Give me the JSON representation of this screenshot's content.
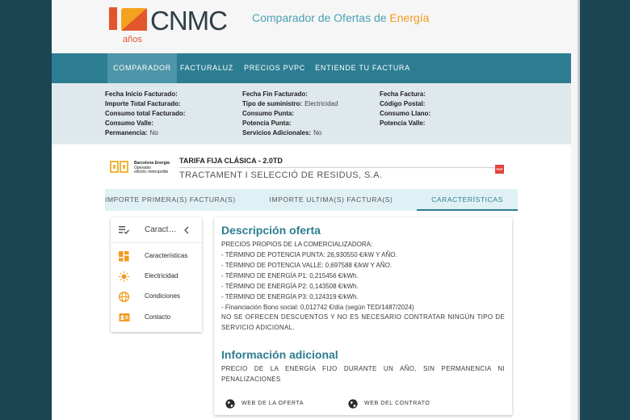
{
  "header": {
    "logo_numeral": "1",
    "logo_years": "años",
    "logo_name": "CNMC",
    "site_title_main": "Comparador de Ofertas de ",
    "site_title_accent": "Energía",
    "accent_color": "#f29a1f",
    "primary_color": "#2d7d92"
  },
  "nav": {
    "items": [
      {
        "label": "COMPARADOR",
        "active": true
      },
      {
        "label": "FACTURALUZ",
        "active": false
      },
      {
        "label": "PRECIOS PVPC",
        "active": false
      },
      {
        "label": "ENTIENDE TU FACTURA",
        "active": false
      }
    ]
  },
  "invoice": {
    "col1": [
      {
        "label": "Fecha Inicio Facturado:",
        "value": ""
      },
      {
        "label": "Importe Total Facturado:",
        "value": ""
      },
      {
        "label": "Consumo total Facturado:",
        "value": ""
      },
      {
        "label": "Consumo Valle:",
        "value": ""
      },
      {
        "label": "Permanencia:",
        "value": "No"
      }
    ],
    "col2": [
      {
        "label": "Fecha Fin Facturado:",
        "value": ""
      },
      {
        "label": "Tipo de suministro:",
        "value": "Electricidad"
      },
      {
        "label": "Consumo Punta:",
        "value": ""
      },
      {
        "label": "Potencia Punta:",
        "value": ""
      },
      {
        "label": "Servicios Adicionales:",
        "value": "No"
      }
    ],
    "col3": [
      {
        "label": "Fecha Factura:",
        "value": ""
      },
      {
        "label": "Código Postal:",
        "value": ""
      },
      {
        "label": "Consumo Llano:",
        "value": ""
      },
      {
        "label": "Potencia Valle:",
        "value": ""
      }
    ]
  },
  "offer": {
    "company_logo_lines": [
      "Barcelona Energia",
      "Operador",
      "elèctric metropolità"
    ],
    "tariff_name": "TARIFA FIJA CLÁSICA - 2.0TD",
    "tariff_subtitle": "TRACTAMENT I SELECCIÓ DE RESIDUS, S.A.",
    "pdf_label": "PDF"
  },
  "tabs": [
    {
      "label": "IMPORTE PRIMERA(S) FACTURA(S)",
      "active": false
    },
    {
      "label": "IMPORTE ULTIMA(S) FACTURA(S)",
      "active": false
    },
    {
      "label": "CARACTERÍSTICAS",
      "active": true
    }
  ],
  "side_menu": {
    "title": "Caract…",
    "items": [
      {
        "label": "Características",
        "icon": "dashboard-icon"
      },
      {
        "label": "Electricidad",
        "icon": "sun-icon"
      },
      {
        "label": "Condiciones",
        "icon": "globe-icon"
      },
      {
        "label": "Contacto",
        "icon": "contact-card-icon"
      }
    ]
  },
  "description": {
    "heading": "Descripción oferta",
    "lines": [
      "PRECIOS PROPIOS DE LA COMERCIALIZADORA:",
      "- TÉRMINO DE POTENCIA PUNTA: 26,930550 €/kW Y AÑO.",
      "- TÉRMINO DE POTENCIA VALLE: 0,697588 €/kW Y AÑO.",
      "- TÉRMINO DE ENERGÍA P1: 0,215456 €/kWh.",
      "- TÉRMINO DE ENERGÍA P2: 0,143508 €/kWh.",
      "- TÉRMINO DE ENERGÍA P3: 0,124319 €/kWh.",
      "- Financiación Bono social: 0,012742 €/día (según TED/1487/2024)"
    ],
    "note": "NO SE OFRECEN DESCUENTOS Y NO ES NECESARIO CONTRATAR NINGÚN TIPO DE SERVICIO ADICIONAL.",
    "extra_heading": "Información adicional",
    "extra_text": "PRECIO DE LA ENERGÍA FIJO DURANTE UN AÑO, SIN PERMANENCIA NI PENALIZACIONES",
    "link_offer": "WEB DE LA OFERTA",
    "link_contract": "WEB DEL CONTRATO"
  }
}
